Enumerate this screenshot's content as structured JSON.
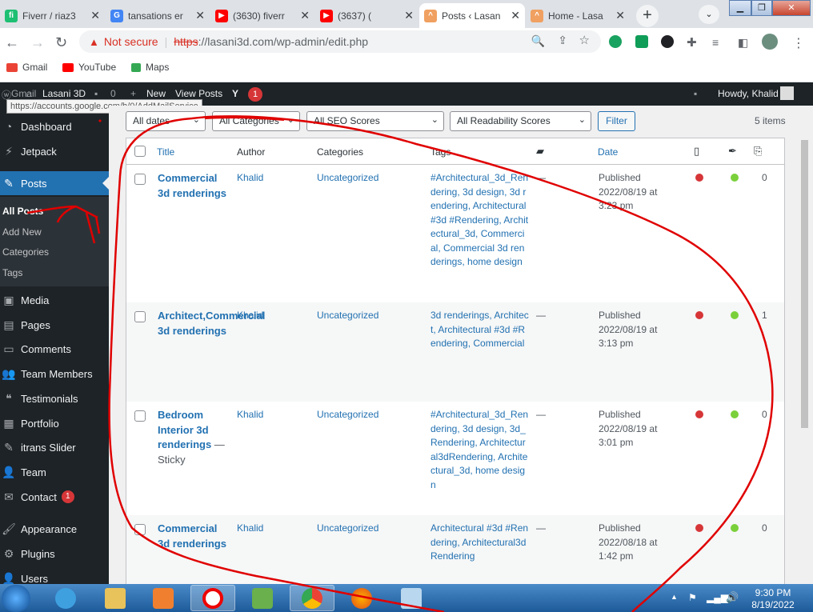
{
  "browser": {
    "tabs": [
      {
        "title": "Fiverr / riaz3",
        "fav": "fiverr-favicon",
        "color": "#1dbf73",
        "fav_text": "fi"
      },
      {
        "title": "tansations er",
        "fav": "google-favicon",
        "color": "#4285f4",
        "fav_text": "G"
      },
      {
        "title": "(3630) fiverr",
        "fav": "youtube-favicon",
        "color": "#ff0000",
        "fav_text": "▶"
      },
      {
        "title": "(3637) (",
        "fav": "youtube-favicon",
        "color": "#ff0000",
        "fav_text": "▶"
      },
      {
        "title": "Posts ‹ Lasan",
        "fav": "wordpress-favicon",
        "color": "#f0a060",
        "fav_text": "^",
        "active": true
      },
      {
        "title": "Home - Lasa",
        "fav": "wordpress-favicon",
        "color": "#f0a060",
        "fav_text": "^"
      }
    ],
    "tab_close": "✕",
    "new_tab": "+",
    "address": {
      "not_secure": "Not secure",
      "scheme": "https",
      "url": "://lasani3d.com/wp-admin/edit.php"
    },
    "bookmarks": [
      {
        "label": "Gmail",
        "icon": "gmail-icon",
        "color": "#ea4335"
      },
      {
        "label": "YouTube",
        "icon": "youtube-icon",
        "color": "#ff0000"
      },
      {
        "label": "Maps",
        "icon": "maps-icon",
        "color": "#34a853"
      }
    ]
  },
  "adminbar": {
    "gmail_overlay": "Gmail",
    "site_name": "Lasani 3D",
    "comments_count": "0",
    "new_label": "New",
    "view_posts": "View Posts",
    "notification_count": "1",
    "howdy": "Howdy, Khalid"
  },
  "tooltip": "https://accounts.google.com/b/0/AddMailService",
  "sidebar": {
    "items": [
      {
        "label": "Dashboard",
        "icon": "dashboard-icon"
      },
      {
        "label": "Jetpack",
        "icon": "jetpack-icon"
      },
      {
        "label": "Posts",
        "icon": "posts-icon"
      },
      {
        "label": "Media",
        "icon": "media-icon"
      },
      {
        "label": "Pages",
        "icon": "pages-icon"
      },
      {
        "label": "Comments",
        "icon": "comments-icon"
      },
      {
        "label": "Team Members",
        "icon": "team-members-icon"
      },
      {
        "label": "Testimonials",
        "icon": "testimonials-icon"
      },
      {
        "label": "Portfolio",
        "icon": "portfolio-icon"
      },
      {
        "label": "itrans Slider",
        "icon": "slider-icon"
      },
      {
        "label": "Team",
        "icon": "team-icon"
      },
      {
        "label": "Contact",
        "icon": "contact-icon",
        "badge": "1"
      },
      {
        "label": "Appearance",
        "icon": "appearance-icon"
      },
      {
        "label": "Plugins",
        "icon": "plugins-icon"
      },
      {
        "label": "Users",
        "icon": "users-icon"
      }
    ],
    "posts_submenu": [
      "All Posts",
      "Add New",
      "Categories",
      "Tags"
    ]
  },
  "filters": {
    "dates": "All dates",
    "categories": "All Categories",
    "seo": "All SEO Scores",
    "readability": "All Readability Scores",
    "filter_button": "Filter",
    "items_count": "5 items"
  },
  "table": {
    "headers": {
      "title": "Title",
      "author": "Author",
      "categories": "Categories",
      "tags": "Tags",
      "date": "Date"
    },
    "rows": [
      {
        "title": "Commercial 3d renderings",
        "sticky": "",
        "author": "Khalid",
        "category": "Uncategorized",
        "tags": "#Architectural_3d_Rendering, 3d design, 3d rendering, Architectural #3d #Rendering, Architectural_3d, Commercial, Commercial 3d renderings, home design",
        "comments": "—",
        "status": "Published",
        "date": "2022/08/19 at 3:23 pm",
        "seo": "#d63638",
        "readability": "#7ad03a",
        "links": "0"
      },
      {
        "title": "Architect,Commercial 3d renderings",
        "sticky": "",
        "author": "Khalid",
        "category": "Uncategorized",
        "tags": "3d renderings, Architect, Architectural #3d #Rendering, Commercial",
        "comments": "—",
        "status": "Published",
        "date": "2022/08/19 at 3:13 pm",
        "seo": "#d63638",
        "readability": "#7ad03a",
        "links": "1"
      },
      {
        "title": "Bedroom Interior 3d renderings",
        "sticky": " — Sticky",
        "author": "Khalid",
        "category": "Uncategorized",
        "tags": "#Architectural_3d_Rendering, 3d design, 3d_Rendering, Architectural3dRendering, Architectural_3d, home design",
        "comments": "—",
        "status": "Published",
        "date": "2022/08/19 at 3:01 pm",
        "seo": "#d63638",
        "readability": "#7ad03a",
        "links": "0"
      },
      {
        "title": "Commercial 3d renderings",
        "sticky": "",
        "author": "Khalid",
        "category": "Uncategorized",
        "tags": "Architectural #3d #Rendering, Architectural3dRendering",
        "comments": "—",
        "status": "Published",
        "date": "2022/08/18 at 1:42 pm",
        "seo": "#d63638",
        "readability": "#7ad03a",
        "links": "0"
      }
    ]
  },
  "taskbar": {
    "time": "9:30 PM",
    "date": "8/19/2022"
  },
  "colors": {
    "wp_blue": "#2271b1",
    "admin_dark": "#1d2327",
    "annotation_red": "#e00000"
  }
}
